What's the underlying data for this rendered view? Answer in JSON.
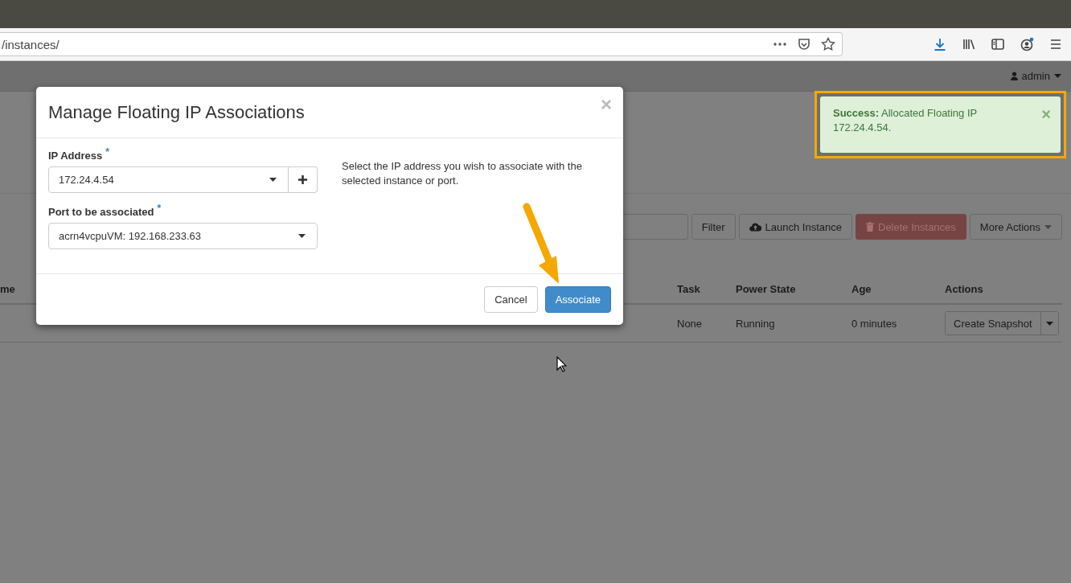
{
  "browser": {
    "url": "/instances/"
  },
  "topbar": {
    "user": "admin"
  },
  "toolbar": {
    "buttons": [
      {
        "label": "Filter",
        "kind": "default",
        "disabled": false
      },
      {
        "label": "Launch Instance",
        "kind": "launch",
        "disabled": false
      },
      {
        "label": "Delete Instances",
        "kind": "danger",
        "disabled": true
      },
      {
        "label": "More Actions",
        "kind": "dropdown",
        "disabled": false
      }
    ]
  },
  "table": {
    "columns": [
      "me",
      "Task",
      "Power State",
      "Age",
      "Actions"
    ],
    "rows": [
      {
        "cells": [
          "",
          "None",
          "Running",
          "0 minutes"
        ],
        "action": "Create Snapshot"
      }
    ]
  },
  "modal": {
    "title": "Manage Floating IP Associations",
    "close": "×",
    "fields": [
      {
        "label": "IP Address",
        "required_mark": "*",
        "value": "172.24.4.54",
        "kind": "select-add"
      },
      {
        "label": "Port to be associated",
        "required_mark": "*",
        "value": "acrn4vcpuVM: 192.168.233.63",
        "kind": "select"
      }
    ],
    "help": "Select the IP address you wish to associate with the selected instance or port.",
    "buttons": [
      {
        "label": "Cancel",
        "kind": "default"
      },
      {
        "label": "Associate",
        "kind": "primary"
      }
    ]
  },
  "toast": {
    "message": "**Success:** Allocated Floating IP 172.24.4.54.",
    "close": "×"
  }
}
